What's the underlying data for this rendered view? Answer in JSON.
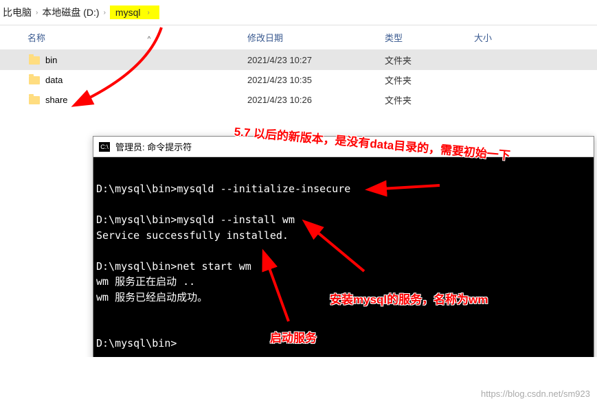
{
  "breadcrumb": {
    "root": "比电脑",
    "drive": "本地磁盘 (D:)",
    "folder": "mysql"
  },
  "columns": {
    "name": "名称",
    "date": "修改日期",
    "type": "类型",
    "size": "大小",
    "sort": "^"
  },
  "rows": [
    {
      "name": "bin",
      "date": "2021/4/23 10:27",
      "type": "文件夹",
      "selected": true
    },
    {
      "name": "data",
      "date": "2021/4/23 10:35",
      "type": "文件夹",
      "selected": false
    },
    {
      "name": "share",
      "date": "2021/4/23 10:26",
      "type": "文件夹",
      "selected": false
    }
  ],
  "terminal": {
    "icon_text": "C:\\",
    "title": "管理员: 命令提示符",
    "lines": "D:\\mysql\\bin>mysqld --initialize-insecure\n\nD:\\mysql\\bin>mysqld --install wm\nService successfully installed.\n\nD:\\mysql\\bin>net start wm\nwm 服务正在启动 ..\nwm 服务已经启动成功。\n\n\nD:\\mysql\\bin>"
  },
  "annotations": {
    "a1_prefix": "5.7 以后的新版本，是没有",
    "a1_bold": "data",
    "a1_suffix": "目录的，需要初始一下",
    "a2_prefix": "安装",
    "a2_bold": "mysql",
    "a2_mid": "的服务，名称为",
    "a2_bold2": "wm",
    "a3": "启动服务"
  },
  "watermark": "https://blog.csdn.net/sm923"
}
